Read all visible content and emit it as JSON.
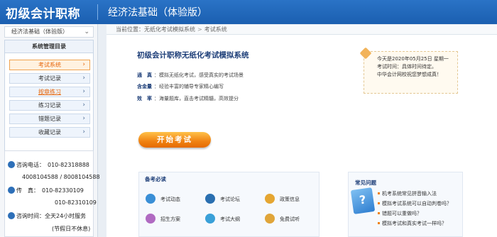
{
  "header": {
    "brand": "初级会计职称",
    "subject": "经济法基础（体验版）"
  },
  "sidebar": {
    "subject_select": "经济法基础（体验版）",
    "menu_title": "系统管理目录",
    "items": [
      {
        "label": "考试系统",
        "state": "active"
      },
      {
        "label": "考试记录",
        "state": "normal"
      },
      {
        "label": "按章练习",
        "state": "link"
      },
      {
        "label": "练习记录",
        "state": "normal"
      },
      {
        "label": "错题记录",
        "state": "normal"
      },
      {
        "label": "收藏记录",
        "state": "normal"
      }
    ]
  },
  "contact": {
    "phone_label": "咨询电话：",
    "phone1": "010-82318888",
    "phone2": "4008104588 / 8008104588",
    "fax_label": "传　真：",
    "fax1": "010-82330109",
    "fax2": "010-82310109",
    "hours_label": "咨询时间：",
    "hours": "全天24小时服务",
    "hours_note": "(节假日不休息)"
  },
  "breadcrumb": {
    "prefix": "当前位置：",
    "path1": "无纸化考试模拟系统",
    "sep": ">",
    "path2": "考试系统"
  },
  "main": {
    "title": "初级会计职称无纸化考试模拟系统",
    "features": [
      {
        "key": "通　真",
        "text": "：模拟无纸化考试，感受真实的考试场景"
      },
      {
        "key": "含金量",
        "text": "：经验丰富的辅导专家精心编写"
      },
      {
        "key": "效　率",
        "text": "：海量题库，直击考试精髓，高效提分"
      }
    ],
    "notice": [
      "今天是2020年05月25日 星期一",
      "考试时间：具体时间待定。",
      "中华会计网校祝您梦想成真！"
    ],
    "start_button": "开始考试"
  },
  "prep": {
    "title": "备考必读",
    "items": [
      {
        "label": "考试动态",
        "icon": "news-icon",
        "color": "#3a8fd6"
      },
      {
        "label": "考试论坛",
        "icon": "forum-icon",
        "color": "#2a6fb0"
      },
      {
        "label": "政策信息",
        "icon": "policy-icon",
        "color": "#e5a632"
      },
      {
        "label": "招生方案",
        "icon": "enroll-icon",
        "color": "#b06ac2"
      },
      {
        "label": "考试大纲",
        "icon": "syllabus-icon",
        "color": "#3aa0d8"
      },
      {
        "label": "免费试听",
        "icon": "audition-icon",
        "color": "#e0a53a"
      }
    ]
  },
  "faq": {
    "title": "常见问题",
    "items": [
      "机考系统常见拼音输入法",
      "模拟考试系统可以自动判卷吗？",
      "错题可以重做吗？",
      "模拟考试和真实考试一样吗？"
    ]
  }
}
